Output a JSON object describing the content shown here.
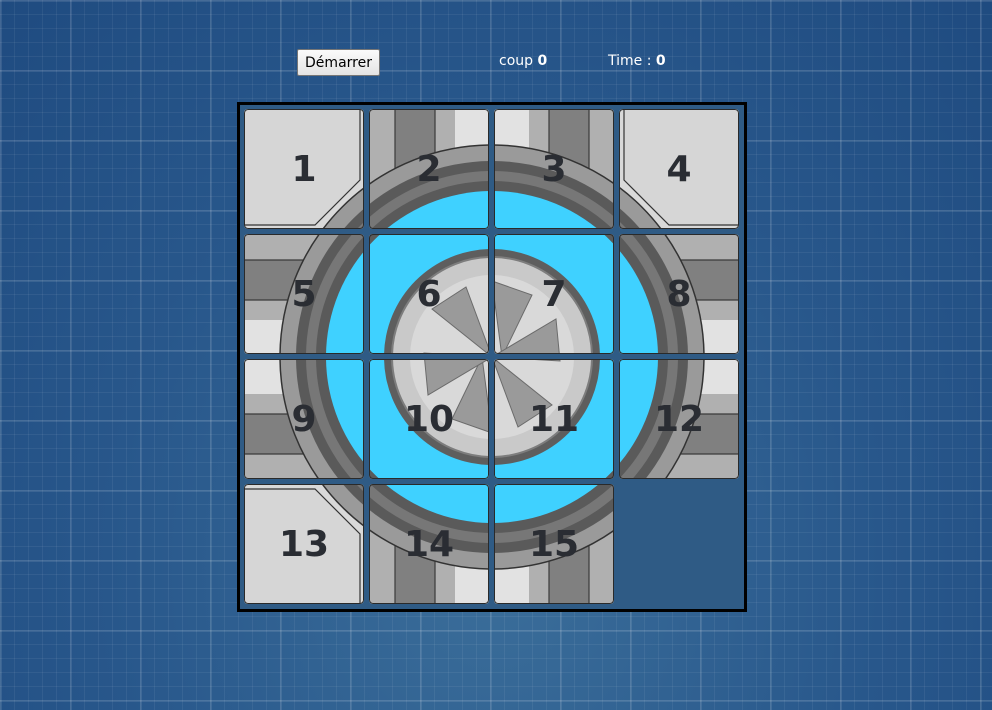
{
  "controls": {
    "start_label": "Démarrer",
    "moves_label": "coup",
    "moves_value": "0",
    "time_label": "Time :",
    "time_value": "0"
  },
  "puzzle": {
    "grid_size": 4,
    "tiles": [
      {
        "label": "1",
        "row": 0,
        "col": 0
      },
      {
        "label": "2",
        "row": 0,
        "col": 1
      },
      {
        "label": "3",
        "row": 0,
        "col": 2
      },
      {
        "label": "4",
        "row": 0,
        "col": 3
      },
      {
        "label": "5",
        "row": 1,
        "col": 0
      },
      {
        "label": "6",
        "row": 1,
        "col": 1
      },
      {
        "label": "7",
        "row": 1,
        "col": 2
      },
      {
        "label": "8",
        "row": 1,
        "col": 3
      },
      {
        "label": "9",
        "row": 2,
        "col": 0
      },
      {
        "label": "10",
        "row": 2,
        "col": 1
      },
      {
        "label": "11",
        "row": 2,
        "col": 2
      },
      {
        "label": "12",
        "row": 2,
        "col": 3
      },
      {
        "label": "13",
        "row": 3,
        "col": 0
      },
      {
        "label": "14",
        "row": 3,
        "col": 1
      },
      {
        "label": "15",
        "row": 3,
        "col": 2
      }
    ],
    "empty": {
      "row": 3,
      "col": 3
    }
  },
  "colors": {
    "background": "#28578b",
    "board_border": "#000000",
    "panel_light": "#d9d9d9",
    "panel_mid": "#a9a9a9",
    "panel_dark": "#808080",
    "ring_dark": "#5a5a5a",
    "core_blue": "#3fd1ff",
    "aperture": "#c9c9c9"
  },
  "icons": {
    "tile_artwork": "portal-aperture-icon"
  }
}
